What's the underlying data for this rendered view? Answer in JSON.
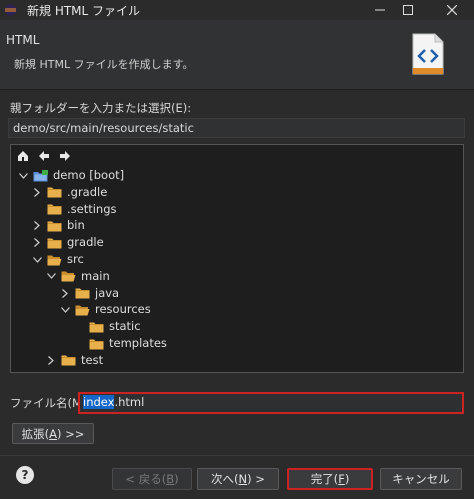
{
  "window": {
    "title": "新規 HTML ファイル",
    "icon": "eclipse-icon"
  },
  "header": {
    "title": "HTML",
    "message": "新規 HTML ファイルを作成します。",
    "icon": "html-file-wizard-icon"
  },
  "parent_folder": {
    "label": "親フォルダーを入力または選択(E):",
    "value": "demo/src/main/resources/static"
  },
  "tree": {
    "toolbar": [
      "home-icon",
      "back-arrow-icon",
      "forward-arrow-icon"
    ],
    "items": [
      {
        "label": "demo [boot]",
        "expanded": true,
        "kind": "project"
      },
      {
        "label": ".gradle",
        "expanded": false,
        "kind": "folder"
      },
      {
        "label": ".settings",
        "expanded": null,
        "kind": "folder"
      },
      {
        "label": "bin",
        "expanded": false,
        "kind": "folder"
      },
      {
        "label": "gradle",
        "expanded": false,
        "kind": "folder"
      },
      {
        "label": "src",
        "expanded": true,
        "kind": "folder"
      },
      {
        "label": "main",
        "expanded": true,
        "kind": "folder"
      },
      {
        "label": "java",
        "expanded": false,
        "kind": "folder"
      },
      {
        "label": "resources",
        "expanded": true,
        "kind": "folder"
      },
      {
        "label": "static",
        "expanded": null,
        "kind": "folder"
      },
      {
        "label": "templates",
        "expanded": null,
        "kind": "folder"
      },
      {
        "label": "test",
        "expanded": false,
        "kind": "folder"
      }
    ]
  },
  "filename": {
    "label": "ファイル名(M):",
    "value_selected": "index",
    "value_rest": ".html"
  },
  "expand_button": {
    "label_prefix": "拡張(",
    "mnemonic": "A",
    "label_suffix": ") >>"
  },
  "buttons": {
    "back": {
      "prefix": "< 戻る(",
      "mnemonic": "B",
      "suffix": ")"
    },
    "next": {
      "prefix": "次へ(",
      "mnemonic": "N",
      "suffix": ") >"
    },
    "finish": {
      "prefix": "完了(",
      "mnemonic": "F",
      "suffix": ")"
    },
    "cancel": {
      "label": "キャンセル"
    }
  },
  "colors": {
    "highlight": "#cc2222",
    "selection": "#1566c9",
    "folder": "#e8b04a"
  }
}
